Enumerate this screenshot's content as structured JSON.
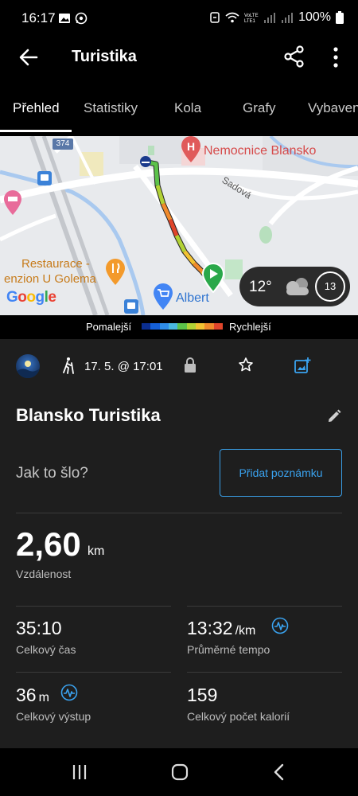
{
  "status": {
    "time": "16:17",
    "battery": "100%"
  },
  "appbar": {
    "title": "Turistika"
  },
  "tabs": [
    {
      "label": "Přehled",
      "active": true
    },
    {
      "label": "Statistiky"
    },
    {
      "label": "Kola"
    },
    {
      "label": "Grafy"
    },
    {
      "label": "Vybavení"
    }
  ],
  "map": {
    "hospital_label": "Nemocnice Blansko",
    "street_label": "Sadová",
    "road_number": "374",
    "restaurant_line1": "Restaurace -",
    "restaurant_line2": "enzion U Golema",
    "store_label": "Albert",
    "google_logo": "Google",
    "weather_temp": "12°",
    "weather_wind": "13"
  },
  "legend": {
    "slower": "Pomalejší",
    "faster": "Rychlejší",
    "colors": [
      "#0b2e8f",
      "#1560d8",
      "#2f8de8",
      "#4ab8e0",
      "#5cc24a",
      "#b2d235",
      "#f2c232",
      "#f08a2c",
      "#e0452b"
    ]
  },
  "activity": {
    "date": "17. 5. @ 17:01",
    "title": "Blansko Turistika",
    "prompt": "Jak to šlo?",
    "add_note": "Přidat poznámku",
    "distance": {
      "value": "2,60",
      "unit": "km",
      "label": "Vzdálenost"
    },
    "stats": [
      {
        "value": "35:10",
        "unit": "",
        "label": "Celkový čas"
      },
      {
        "value": "13:32",
        "unit": "/km",
        "label": "Průměrné tempo"
      },
      {
        "value": "36",
        "unit": "m",
        "label": "Celkový výstup"
      },
      {
        "value": "159",
        "unit": "",
        "label": "Celkový počet kalorií"
      }
    ]
  },
  "accent_color": "#3aa3f0"
}
